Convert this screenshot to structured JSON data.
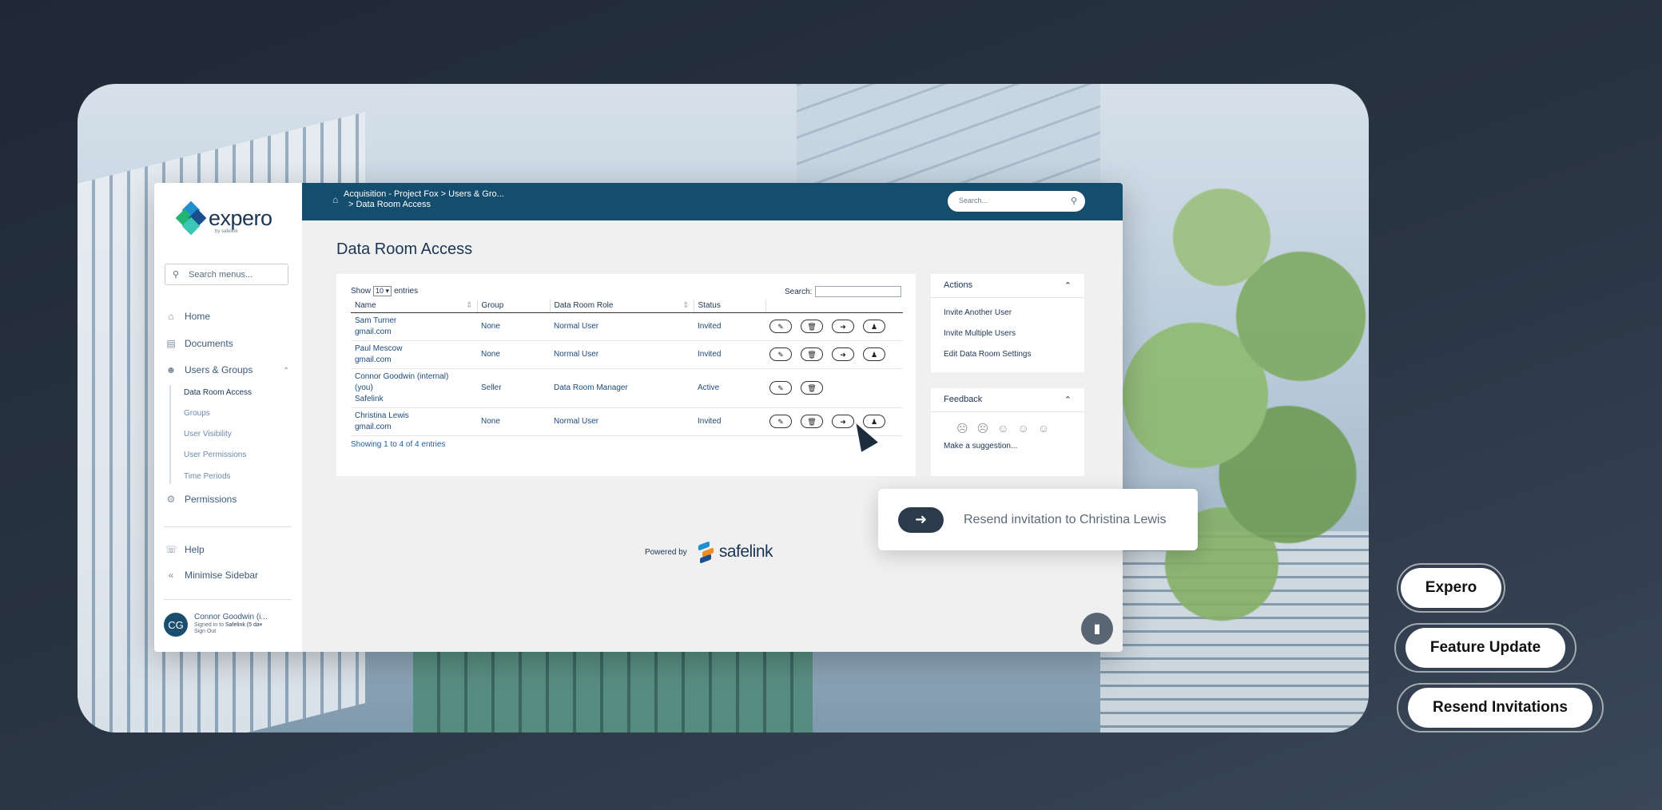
{
  "sidebar": {
    "logo_text": "expero",
    "logo_by": "by safelink",
    "search_placeholder": "Search menus...",
    "items": [
      {
        "label": "Home",
        "icon": "home-icon"
      },
      {
        "label": "Documents",
        "icon": "documents-icon"
      },
      {
        "label": "Users & Groups",
        "icon": "users-icon"
      },
      {
        "label": "Permissions",
        "icon": "permissions-icon"
      },
      {
        "label": "Help",
        "icon": "help-icon"
      },
      {
        "label": "Minimise Sidebar",
        "icon": "chevrons-left-icon"
      }
    ],
    "sub_items": [
      "Data Room Access",
      "Groups",
      "User Visibility",
      "User Permissions",
      "Time Periods"
    ],
    "user": {
      "initials": "CG",
      "name": "Connor Goodwin (i...",
      "signed_in": "Signed in to",
      "org": "Safelink (5 da",
      "sign_out": "Sign Out"
    }
  },
  "topbar": {
    "breadcrumb_1": "Acquisition - Project Fox  >  Users & Gro...",
    "breadcrumb_2": ">  Data Room Access",
    "search_placeholder": "Search..."
  },
  "main": {
    "title": "Data Room Access",
    "show_label": "Show",
    "entries_value": "10",
    "entries_label": "entries",
    "search_label": "Search:",
    "columns": [
      "Name",
      "Group",
      "Data Room Role",
      "Status"
    ],
    "rows": [
      {
        "name": "Sam Turner",
        "email": "gmail.com",
        "group": "None",
        "role": "Normal User",
        "status": "Invited"
      },
      {
        "name": "Paul Mescow",
        "email": "gmail.com",
        "group": "None",
        "role": "Normal User",
        "status": "Invited"
      },
      {
        "name": "Connor Goodwin (internal) (you)",
        "email": "Safelink",
        "group": "Seller",
        "role": "Data Room Manager",
        "status": "Active"
      },
      {
        "name": "Christina Lewis",
        "email": "gmail.com",
        "group": "None",
        "role": "Normal User",
        "status": "Invited"
      }
    ],
    "footer": "Showing 1 to 4 of 4 entries"
  },
  "actions_panel": {
    "title": "Actions",
    "items": [
      "Invite Another User",
      "Invite Multiple Users",
      "Edit Data Room Settings"
    ]
  },
  "feedback_panel": {
    "title": "Feedback",
    "suggestion": "Make a suggestion..."
  },
  "powered_by": {
    "label": "Powered by",
    "brand": "safelink"
  },
  "callout": {
    "text": "Resend invitation to Christina Lewis"
  },
  "tags": [
    "Expero",
    "Feature Update",
    "Resend Invitations"
  ]
}
